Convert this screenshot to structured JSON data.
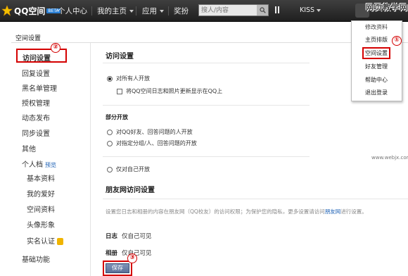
{
  "topbar": {
    "logo_text": "QQ空间",
    "beta": "BETA",
    "nav": [
      "个人中心",
      "我的主页",
      "应用",
      "奖扮"
    ],
    "search_placeholder": "搜人/内容",
    "pause": "II",
    "user": "KISS"
  },
  "watermark": {
    "cn": "网页教学网",
    "url": "www.webjx.com"
  },
  "page_title": "空间设置",
  "sidebar": {
    "selected": "访问设置",
    "items": [
      "回复设置",
      "黑名单管理",
      "授权管理",
      "动态发布",
      "同步设置",
      "其他"
    ],
    "profile": {
      "label": "个人档",
      "badge": "预览"
    },
    "sub_items": [
      "基本资料",
      "我的爱好",
      "空间资料",
      "头像形象",
      "实名认证"
    ],
    "last": "基础功能"
  },
  "main": {
    "title": "访问设置",
    "option_public": "对所有人开放",
    "check_qq": "将QQ空间日志和照片更新显示在QQ上",
    "partial_title": "部分开放",
    "option_qq_friends": "对QQ好友、回答问题的人开放",
    "option_groups": "对指定分组/人、回答问题的开放",
    "option_self": "仅对自己开放",
    "friend_title": "朋友网访问设置",
    "friend_desc_1": "设置您日志和相册的内容在朋友网（QQ校友）的访问权限；为保护您的隐私，更多设置请访问",
    "friend_link": "朋友网",
    "friend_desc_2": "进行设置。",
    "log_label": "日志",
    "log_value": "仅自己可见",
    "album_label": "相册",
    "album_value": "仅自己可见",
    "save": "保存"
  },
  "dropdown": {
    "items": [
      "修改资料",
      "主页排版",
      "空间设置",
      "好友管理",
      "帮助中心",
      "退出登录"
    ]
  },
  "markers": [
    "①",
    "②",
    "③"
  ],
  "colors": {
    "accent_red": "#d40000",
    "topbar": "#2a2a2a",
    "link": "#1a5fb4"
  }
}
